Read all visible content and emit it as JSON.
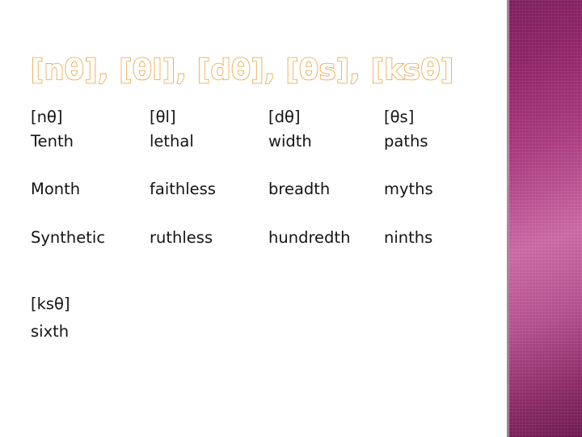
{
  "slide": {
    "title": "[nθ], [θl], [dθ], [θs], [ksθ]",
    "columns": [
      {
        "header": "[nθ]",
        "words": [
          "Tenth",
          "Month",
          "Synthetic"
        ]
      },
      {
        "header": "[θl]",
        "words": [
          "lethal",
          "faithless",
          "ruthless"
        ]
      },
      {
        "header": "[dθ]",
        "words": [
          "width",
          "breadth",
          "hundredth"
        ]
      },
      {
        "header": "[θs]",
        "words": [
          "paths",
          "myths",
          "ninths"
        ]
      }
    ],
    "extra": {
      "header": "[ksθ]",
      "word": "sixth"
    }
  },
  "colors": {
    "title_fill": "#ffffff",
    "title_outline": "#e8a33d",
    "band_dark": "#7d1f5e",
    "band_light": "#c968a3",
    "text": "#141414",
    "background": "#ffffff"
  }
}
